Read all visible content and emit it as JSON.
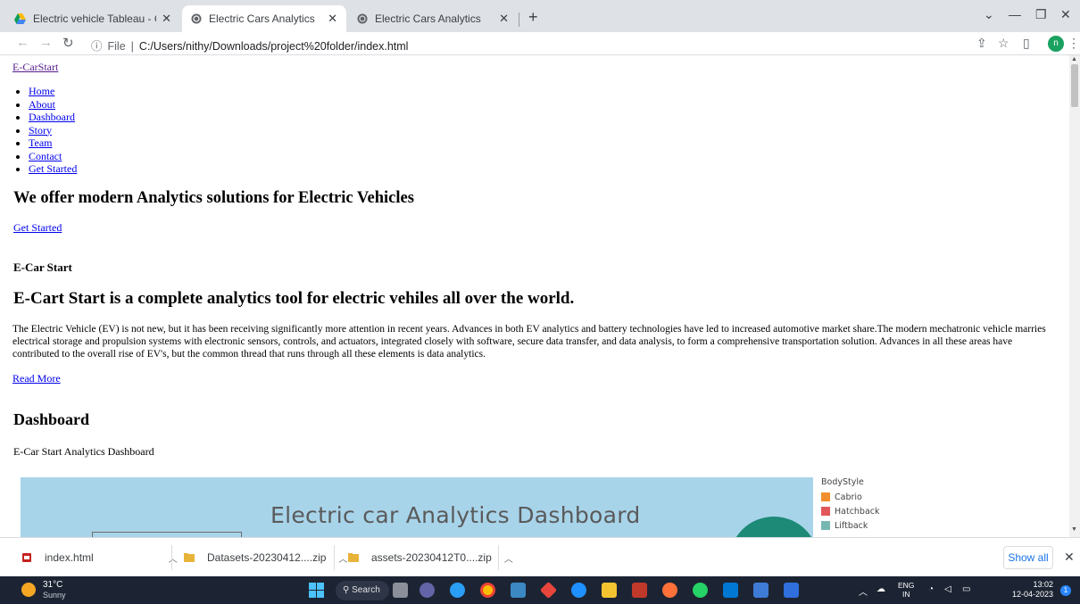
{
  "browser": {
    "tabs": [
      {
        "title": "Electric vehicle Tableau - Google",
        "icon": "google-drive-icon"
      },
      {
        "title": "Electric Cars Analytics",
        "icon": "globe-icon"
      },
      {
        "title": "Electric Cars Analytics",
        "icon": "globe-icon"
      }
    ],
    "url_prefix": "File",
    "url": "C:/Users/nithy/Downloads/project%20folder/index.html",
    "profile_initial": "n"
  },
  "page": {
    "brand": "E-CarStart",
    "nav": [
      "Home",
      "About",
      "Dashboard",
      "Story",
      "Team",
      "Contact",
      "Get Started"
    ],
    "hero": {
      "title": "We offer modern Analytics solutions for Electric Vehicles",
      "cta": "Get Started"
    },
    "about": {
      "kicker": "E-Car Start",
      "title": "E-Cart Start is a complete analytics tool for electric vehiles all over the world.",
      "body": "The Electric Vehicle (EV) is not new, but it has been receiving significantly more attention in recent years. Advances in both EV analytics and battery technologies have led to increased automotive market share.The modern mechatronic vehicle marries electrical storage and propulsion systems with electronic sensors, controls, and actuators, integrated closely with software, secure data transfer, and data analysis, to form a comprehensive transportation solution. Advances in all these areas have contributed to the overall rise of EV's, but the common thread that runs through all these elements is data analytics.",
      "read_more": "Read More"
    },
    "dashboard": {
      "title": "Dashboard",
      "subtitle": "E-Car Start Analytics Dashboard",
      "embed_title": "Electric car Analytics Dashboard",
      "legend_title": "BodyStyle",
      "legend": [
        {
          "label": "Cabrio",
          "color": "#f28e2b"
        },
        {
          "label": "Hatchback",
          "color": "#e15759"
        },
        {
          "label": "Liftback",
          "color": "#76b7b2"
        }
      ]
    }
  },
  "downloads": {
    "items": [
      {
        "name": "index.html",
        "icon": "html-file-icon"
      },
      {
        "name": "Datasets-20230412....zip",
        "icon": "zip-folder-icon"
      },
      {
        "name": "assets-20230412T0....zip",
        "icon": "zip-folder-icon"
      }
    ],
    "show_all": "Show all"
  },
  "taskbar": {
    "weather_temp": "31°C",
    "weather_cond": "Sunny",
    "search": "Search",
    "lang_1": "ENG",
    "lang_2": "IN",
    "time": "13:02",
    "date": "12-04-2023",
    "notifications": "1"
  }
}
